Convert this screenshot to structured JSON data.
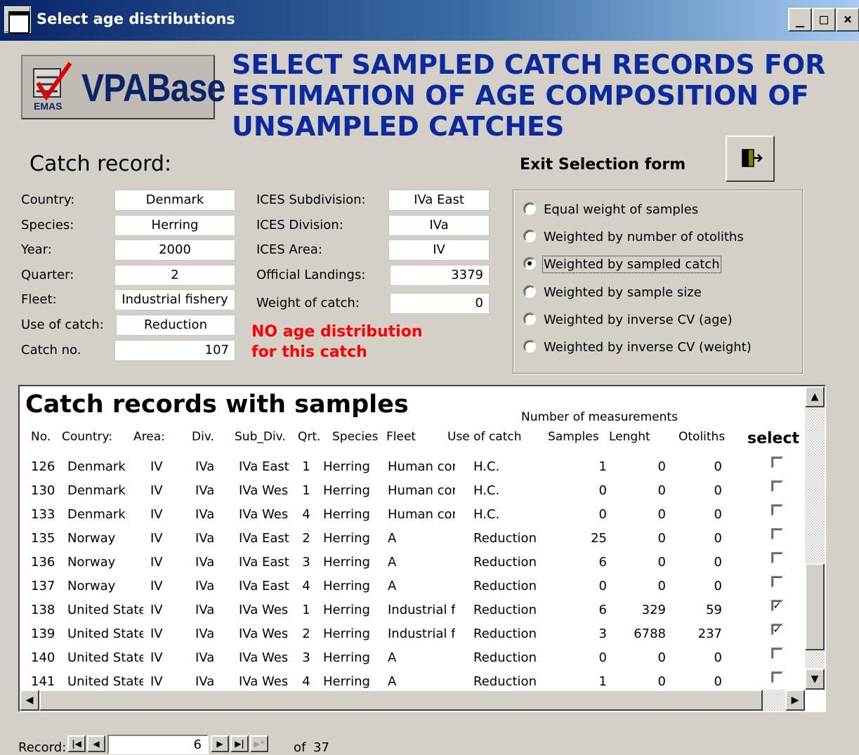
{
  "window": {
    "title": "Select age distributions",
    "minimize": "_",
    "maximize": "□",
    "close": "×"
  },
  "logo": {
    "text": "VPABase",
    "emas": "EMAS"
  },
  "heading": "SELECT SAMPLED CATCH RECORDS FOR ESTIMATION OF AGE COMPOSITION OF UNSAMPLED CATCHES",
  "catch_record": {
    "title": "Catch record:",
    "country_label": "Country:",
    "country": "Denmark",
    "species_label": "Species:",
    "species": "Herring",
    "year_label": "Year:",
    "year": "2000",
    "quarter_label": "Quarter:",
    "quarter": "2",
    "fleet_label": "Fleet:",
    "fleet": "Industrial fishery",
    "use_label": "Use of catch:",
    "use": "Reduction",
    "catchno_label": "Catch no.",
    "catchno": "107",
    "subdiv_label": "ICES Subdivision:",
    "subdiv": "IVa East",
    "division_label": "ICES Division:",
    "division": "IVa",
    "area_label": "ICES Area:",
    "area": "IV",
    "landings_label": "Official Landings:",
    "landings": "3379",
    "weight_label": "Weight of catch:",
    "weight": "0",
    "warning_line1": "NO age distribution",
    "warning_line2": "for this catch"
  },
  "exit": {
    "label": "Exit  Selection form",
    "icon": "exit-door-icon"
  },
  "weighting_options": [
    {
      "label": "Equal weight of samples",
      "selected": false
    },
    {
      "label": "Weighted by number of otoliths",
      "selected": false
    },
    {
      "label": "Weighted by sampled catch",
      "selected": true
    },
    {
      "label": "Weighted by sample size",
      "selected": false
    },
    {
      "label": "Weighted by inverse CV (age)",
      "selected": false
    },
    {
      "label": "Weighted by inverse CV (weight)",
      "selected": false
    }
  ],
  "subform": {
    "title": "Catch records with samples",
    "measurements_header": "Number of measurements",
    "columns": [
      "No.",
      "Country:",
      "Area:",
      "Div.",
      "Sub_Div.",
      "Qrt.",
      "Species",
      "Fleet",
      "Use of catch",
      "Samples",
      "Lenght",
      "Otoliths",
      "select"
    ],
    "rows": [
      [
        "126",
        "Denmark",
        "IV",
        "IVa",
        "IVa East",
        "1",
        "Herring",
        "Human cons",
        "H.C.",
        "1",
        "0",
        "0",
        false
      ],
      [
        "130",
        "Denmark",
        "IV",
        "IVa",
        "IVa Wes",
        "1",
        "Herring",
        "Human cons",
        "H.C.",
        "0",
        "0",
        "0",
        false
      ],
      [
        "133",
        "Denmark",
        "IV",
        "IVa",
        "IVa Wes",
        "4",
        "Herring",
        "Human cons",
        "H.C.",
        "0",
        "0",
        "0",
        false
      ],
      [
        "135",
        "Norway",
        "IV",
        "IVa",
        "IVa East",
        "2",
        "Herring",
        "A",
        "Reduction",
        "25",
        "0",
        "0",
        false
      ],
      [
        "136",
        "Norway",
        "IV",
        "IVa",
        "IVa East",
        "3",
        "Herring",
        "A",
        "Reduction",
        "6",
        "0",
        "0",
        false
      ],
      [
        "137",
        "Norway",
        "IV",
        "IVa",
        "IVa East",
        "4",
        "Herring",
        "A",
        "Reduction",
        "0",
        "0",
        "0",
        false
      ],
      [
        "138",
        "United State",
        "IV",
        "IVa",
        "IVa Wes",
        "1",
        "Herring",
        "Industrial fis",
        "Reduction",
        "6",
        "329",
        "59",
        true
      ],
      [
        "139",
        "United State",
        "IV",
        "IVa",
        "IVa Wes",
        "2",
        "Herring",
        "Industrial fis",
        "Reduction",
        "3",
        "6788",
        "237",
        true
      ],
      [
        "140",
        "United State",
        "IV",
        "IVa",
        "IVa Wes",
        "3",
        "Herring",
        "A",
        "Reduction",
        "0",
        "0",
        "0",
        false
      ],
      [
        "141",
        "United State",
        "IV",
        "IVa",
        "IVa Wes",
        "4",
        "Herring",
        "A",
        "Reduction",
        "1",
        "0",
        "0",
        false
      ]
    ]
  },
  "navigation": {
    "label": "Record:",
    "current": "6",
    "of_label": "of",
    "total": "37"
  }
}
